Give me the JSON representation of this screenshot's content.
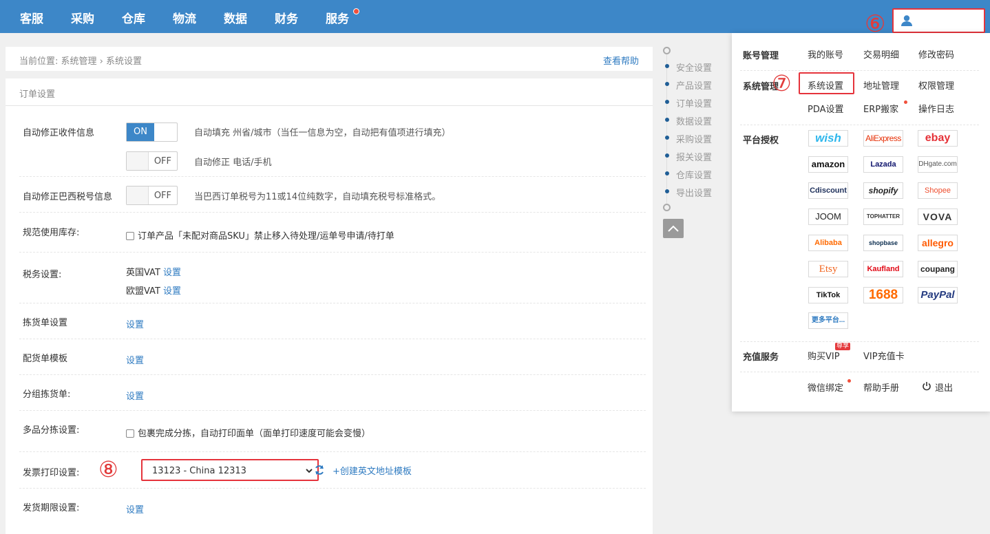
{
  "nav": {
    "items": [
      "客服",
      "采购",
      "仓库",
      "物流",
      "数据",
      "财务",
      "服务"
    ]
  },
  "markers": {
    "six": "⑥",
    "seven": "⑦",
    "eight": "⑧"
  },
  "breadcrumb": {
    "text": "当前位置:  系统管理 › 系统设置",
    "help": "查看帮助"
  },
  "section_title": "订单设置",
  "settings": {
    "auto_fix": {
      "label": "自动修正收件信息",
      "toggle1": "ON",
      "desc1": "自动填充 州省/城市（当任一信息为空，自动把有值项进行填充）",
      "toggle2": "OFF",
      "desc2": "自动修正 电话/手机"
    },
    "brazil": {
      "label": "自动修正巴西税号信息",
      "toggle": "OFF",
      "desc": "当巴西订单税号为11或14位纯数字，自动填充税号标准格式。"
    },
    "stock": {
      "label": "规范使用库存:",
      "checkbox": "订单产品「未配对商品SKU」禁止移入待处理/运单号申请/待打单"
    },
    "tax": {
      "label": "税务设置:",
      "uk": "英国VAT",
      "eu": "欧盟VAT",
      "set": "设置"
    },
    "pick": {
      "label": "拣货单设置",
      "link": "设置"
    },
    "dist": {
      "label": "配货单模板",
      "link": "设置"
    },
    "group": {
      "label": "分组拣货单:",
      "link": "设置"
    },
    "multi": {
      "label": "多品分拣设置:",
      "checkbox": "包裹完成分拣，自动打印面单（面单打印速度可能会变慢）"
    },
    "invoice": {
      "label": "发票打印设置:",
      "value": "13123 - China 12313",
      "create": "+创建英文地址模板"
    },
    "ship": {
      "label": "发货期限设置:",
      "link": "设置"
    }
  },
  "side_nav": [
    "安全设置",
    "产品设置",
    "订单设置",
    "数据设置",
    "采购设置",
    "报关设置",
    "仓库设置",
    "导出设置"
  ],
  "dropdown": {
    "account": {
      "title": "账号管理",
      "items": [
        "我的账号",
        "交易明细",
        "修改密码"
      ]
    },
    "system": {
      "title": "系统管理",
      "items": [
        "系统设置",
        "地址管理",
        "权限管理",
        "PDA设置",
        "ERP搬家",
        "操作日志"
      ]
    },
    "platform": {
      "title": "平台授权",
      "logos": [
        "wish",
        "AliExpress",
        "ebay",
        "amazon",
        "Lazada",
        "DHgate.com",
        "Cdiscount",
        "shopify",
        "Shopee",
        "JOOM",
        "TOPHATTER",
        "VOVA",
        "Alibaba",
        "shopbase",
        "allegro",
        "Etsy",
        "Kaufland",
        "coupang",
        "TikTok",
        "1688",
        "PayPal",
        "更多平台..."
      ]
    },
    "recharge": {
      "title": "充值服务",
      "items": [
        "购买VIP",
        "VIP充值卡"
      ],
      "badge": "尊享"
    },
    "misc": {
      "items": [
        "微信绑定",
        "帮助手册",
        "退出"
      ]
    }
  },
  "colors": {
    "topbar": "#3d87c8",
    "accent": "#2f7bc1",
    "highlight": "#e5333b"
  }
}
